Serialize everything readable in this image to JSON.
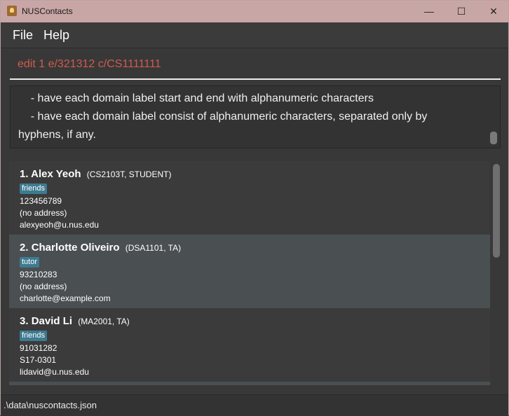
{
  "window": {
    "title": "NUSContacts"
  },
  "titlebar_controls": {
    "minimize": "—",
    "maximize": "☐",
    "close": "✕"
  },
  "menu": {
    "file": "File",
    "help": "Help"
  },
  "command": {
    "value": "edit 1 e/321312 c/CS1111111"
  },
  "result": {
    "lines": [
      "    - have each domain label start and end with alphanumeric characters",
      "    - have each domain label consist of alphanumeric characters, separated only by",
      "hyphens, if any."
    ]
  },
  "persons": [
    {
      "index": "1.",
      "name": "Alex Yeoh",
      "meta": "(CS2103T, STUDENT)",
      "tag": "friends",
      "phone": "123456789",
      "address": "(no address)",
      "email": "alexyeoh@u.nus.edu",
      "selected": false
    },
    {
      "index": "2.",
      "name": "Charlotte Oliveiro",
      "meta": "(DSA1101, TA)",
      "tag": "tutor",
      "phone": "93210283",
      "address": "(no address)",
      "email": "charlotte@example.com",
      "selected": true
    },
    {
      "index": "3.",
      "name": "David Li",
      "meta": "(MA2001, TA)",
      "tag": "friends",
      "phone": "91031282",
      "address": "S17-0301",
      "email": "lidavid@u.nus.edu",
      "selected": false
    }
  ],
  "status": {
    "path": ".\\data\\nuscontacts.json"
  },
  "icons": {
    "app": "app-icon",
    "minimize": "minimize-icon",
    "maximize": "maximize-icon",
    "close": "close-icon"
  },
  "colors": {
    "titlebar": "#c9a6a6",
    "command_text": "#d15b4d",
    "tag": "#3e7b91",
    "selected_card": "#4a4f52"
  }
}
